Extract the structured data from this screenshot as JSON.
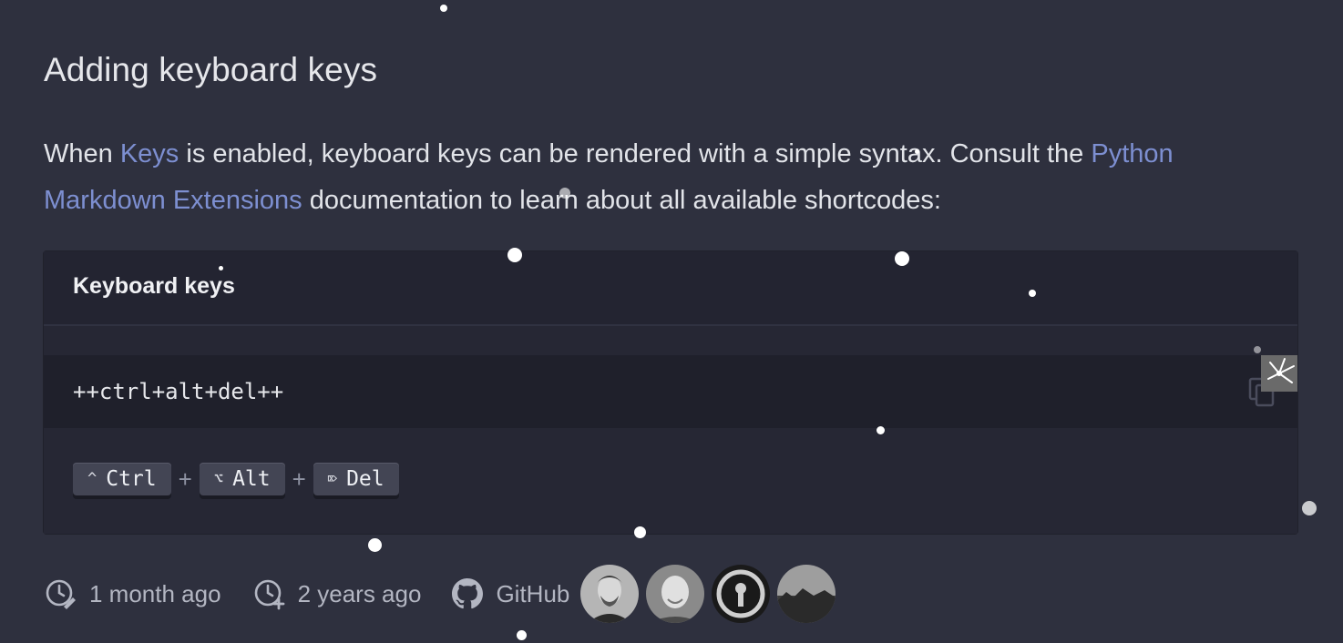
{
  "heading": "Adding keyboard keys",
  "intro": {
    "part1": "When ",
    "link1": "Keys",
    "part2": " is enabled, keyboard keys can be rendered with a simple syntax. Consult the ",
    "link2": "Python Markdown Extensions",
    "part3": " documentation to learn about all available shortcodes:"
  },
  "example": {
    "title": "Keyboard keys",
    "code": "++ctrl+alt+del++",
    "keys": [
      {
        "symbol": "^",
        "label": "Ctrl"
      },
      {
        "symbol": "⌥",
        "label": "Alt"
      },
      {
        "symbol": "⌦",
        "label": "Del"
      }
    ],
    "separator": "+"
  },
  "meta": {
    "updated": "1 month ago",
    "created": "2 years ago",
    "source": "GitHub"
  },
  "colors": {
    "background": "#2e303e",
    "link": "#7d8fd1",
    "code_bg": "#1f202b"
  }
}
